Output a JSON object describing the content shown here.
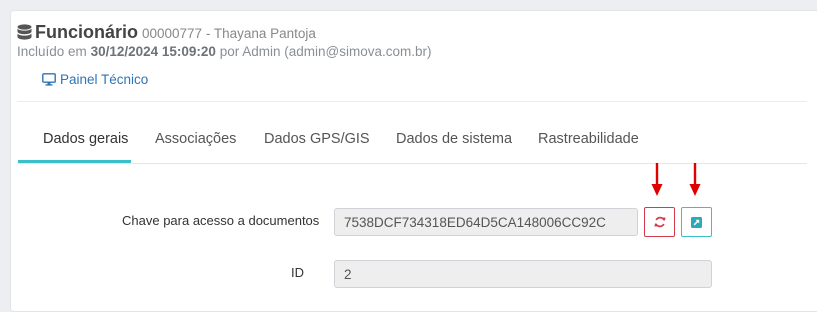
{
  "header": {
    "title": "Funcionário",
    "code_name": "00000777 - Thayana Pantoja",
    "included_prefix": "Incluído em",
    "included_date": "30/12/2024 15:09:20",
    "included_by_prefix": "por",
    "included_by": "Admin (admin@simova.com.br)",
    "icon": "database-icon"
  },
  "painel": {
    "label": "Painel Técnico",
    "icon": "monitor-icon"
  },
  "tabs": [
    {
      "label": "Dados gerais",
      "active": true
    },
    {
      "label": "Associações",
      "active": false
    },
    {
      "label": "Dados GPS/GIS",
      "active": false
    },
    {
      "label": "Dados de sistema",
      "active": false
    },
    {
      "label": "Rastreabilidade",
      "active": false
    }
  ],
  "form": {
    "access_key_label": "Chave para acesso a documentos",
    "access_key_value": "7538DCF734318ED64D5CA148006CC92C",
    "refresh_icon": "refresh-icon",
    "open_icon": "external-link-icon",
    "id_label": "ID",
    "id_value": "2"
  },
  "colors": {
    "accent": "#3bbfc8",
    "link": "#2f74b5",
    "danger": "#d43b4a",
    "annotation_arrow": "#e00000"
  }
}
